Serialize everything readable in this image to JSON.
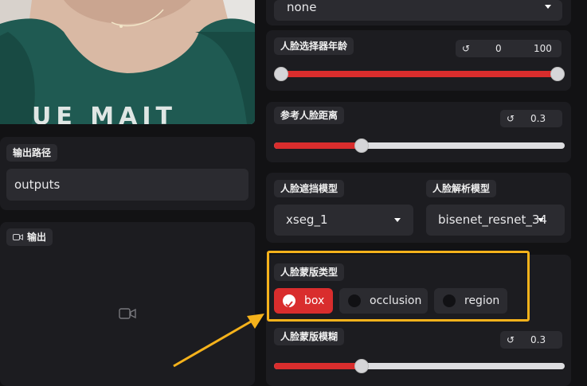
{
  "colors": {
    "accent": "#d92d2d",
    "highlight": "#f5b21b",
    "panel": "#1c1c20",
    "field": "#2b2b30"
  },
  "left": {
    "output_path": {
      "label": "输出路径",
      "value": "outputs"
    },
    "output_panel": {
      "label": "输出",
      "icon": "video-camera-icon"
    }
  },
  "right": {
    "top_dropdown": {
      "value": "none"
    },
    "face_selector_age": {
      "label": "人脸选择器年龄",
      "min_value": "0",
      "max_value": "100",
      "range": [
        0,
        100
      ]
    },
    "reference_face_distance": {
      "label": "参考人脸距离",
      "value": "0.3",
      "fraction": 0.3
    },
    "face_occluder_model": {
      "label": "人脸遮挡模型",
      "value": "xseg_1"
    },
    "face_parser_model": {
      "label": "人脸解析模型",
      "value": "bisenet_resnet_34"
    },
    "face_mask_types": {
      "label": "人脸蒙版类型",
      "options": [
        {
          "label": "box",
          "checked": true
        },
        {
          "label": "occlusion",
          "checked": false
        },
        {
          "label": "region",
          "checked": false
        }
      ]
    },
    "face_mask_blur": {
      "label": "人脸蒙版模糊",
      "value": "0.3",
      "fraction": 0.3
    }
  }
}
